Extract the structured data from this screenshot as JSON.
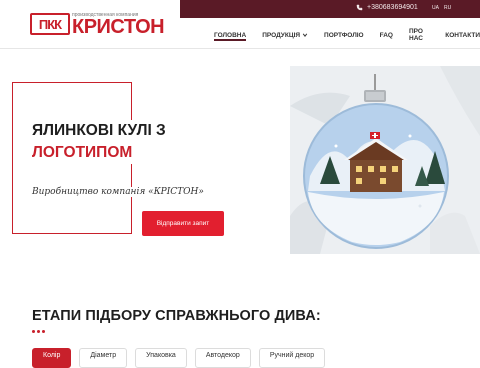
{
  "header": {
    "logo_mark": "ПКК",
    "logo_tagline": "производственная компания",
    "logo_name": "КРИСТОН",
    "phone": "+380683694901",
    "languages": [
      "UA",
      "RU"
    ]
  },
  "nav": {
    "items": [
      {
        "label": "ГОЛОВНА",
        "active": true
      },
      {
        "label": "ПРОДУКЦІЯ",
        "has_dropdown": true
      },
      {
        "label": "ПОРТФОЛІО"
      },
      {
        "label": "FAQ"
      },
      {
        "label": "ПРО НАС"
      },
      {
        "label": "КОНТАКТИ"
      }
    ]
  },
  "hero": {
    "title_line1": "ЯЛИНКОВІ КУЛІ З",
    "title_line2": "ЛОГОТИПОМ",
    "subtitle": "Виробництво компанія «КРІСТОН»",
    "cta_label": "Відправити запит"
  },
  "section": {
    "title": "ЕТАПИ ПІДБОРУ СПРАВЖНЬОГО ДИВА:",
    "tabs": [
      "Колір",
      "Діаметр",
      "Упаковка",
      "Автодекор",
      "Ручний декор"
    ]
  },
  "colors": {
    "brand_red": "#c8202b",
    "topbar": "#5a1a26",
    "cta": "#e21f2f"
  }
}
